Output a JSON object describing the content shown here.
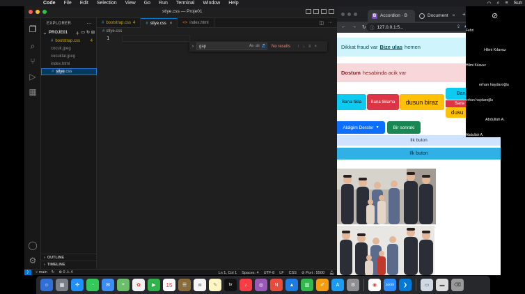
{
  "menubar": {
    "app_name": "Code",
    "menus": [
      "File",
      "Edit",
      "Selection",
      "View",
      "Go",
      "Run",
      "Terminal",
      "Window",
      "Help"
    ],
    "window_title": "stlye.css — Proje01",
    "clock": "Sun"
  },
  "vscode": {
    "explorer_title": "EXPLORER",
    "project": "PROJE01",
    "files": [
      {
        "name": "bootstrap.css",
        "badge": "4"
      },
      {
        "name": "cocuk.jpeg"
      },
      {
        "name": "cocuklar.jpeg"
      },
      {
        "name": "index.html"
      },
      {
        "name_hl": "stlye",
        "name_rest": ".css"
      }
    ],
    "outline_label": "OUTLINE",
    "timeline_label": "TIMELINE",
    "tabs": [
      {
        "label": "bootstrap.css",
        "badge": "4"
      },
      {
        "label": "stlye.css"
      },
      {
        "label": "index.html"
      }
    ],
    "breadcrumb": "stlye.css",
    "line_number": "1",
    "find": {
      "query": "gap",
      "status": "No results",
      "opt_case": "Aa",
      "opt_word": "ab",
      "opt_regex": ".*"
    },
    "status": {
      "branch": "main",
      "problems": "⊗ 0 ⚠ 4",
      "position": "Ln 1, Col 1",
      "spaces": "Spaces: 4",
      "encoding": "UTF-8",
      "eol": "LF",
      "language": "CSS",
      "port": "⊘ Port : 5500"
    }
  },
  "chrome": {
    "tabs": [
      {
        "label": "Accordion · B",
        "favicon": "B"
      },
      {
        "label": "Document"
      }
    ],
    "url": "127.0.0.1:5..."
  },
  "page": {
    "alert_info": {
      "prefix": "Dikkat fraud var",
      "link": "Bize ulas",
      "suffix": "hemen"
    },
    "alert_danger": {
      "strong": "Dostum",
      "rest": "hesabinda acik var"
    },
    "buttons": {
      "info": "Bana tikla",
      "danger": "Bana tiklama",
      "warning": "dusun biraz",
      "stack_info": "Bana",
      "stack_danger": "Bana",
      "stack_warning": "dusu"
    },
    "dropdown_label": "Aldigim Dersler",
    "success_label": "Bir sonraki",
    "accordion_1": "Ilk buton",
    "accordion_2": "Ilk buton"
  },
  "participants": [
    "Fehri",
    "Hilmi Kılavuz",
    "Hilmi Kılavuz",
    "erhan haydaroğlu",
    "erhan haydaroğlu",
    "Abdullah A.",
    "Abdullah A."
  ],
  "dock": {
    "calendar_date": "15",
    "tv_label": "tv"
  },
  "colors": {
    "vscode_bg": "#1f1f1f",
    "accent_blue": "#0078d4",
    "warning": "#cca700",
    "bs_info": "#0dcaf0",
    "bs_danger": "#dc3545",
    "bs_warning": "#ffc107",
    "bs_primary": "#0d6efd",
    "bs_success": "#198754"
  }
}
